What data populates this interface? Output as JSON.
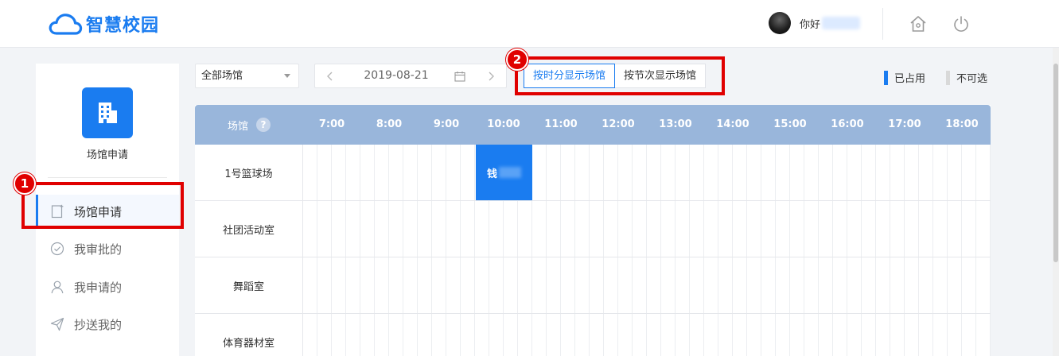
{
  "header": {
    "app_title": "智慧校园",
    "greeting": "你好",
    "brand_color": "#1a7cf0"
  },
  "sidebar": {
    "brand_label": "场馆申请",
    "items": [
      {
        "label": "场馆申请",
        "icon": "document-icon",
        "active": true
      },
      {
        "label": "我审批的",
        "icon": "check-circle-icon",
        "active": false
      },
      {
        "label": "我申请的",
        "icon": "person-icon",
        "active": false
      },
      {
        "label": "抄送我的",
        "icon": "send-icon",
        "active": false
      }
    ]
  },
  "toolbar": {
    "venue_select": "全部场馆",
    "date": "2019-08-21",
    "mode_by_time": "按时分显示场馆",
    "mode_by_period": "按节次显示场馆",
    "active_mode": "by_time"
  },
  "legend": {
    "occupied_label": "已占用",
    "occupied_color": "#1a7cf0",
    "unavailable_label": "不可选",
    "unavailable_color": "#d9d9d9"
  },
  "annotations": {
    "badge_1": "1",
    "badge_2": "2",
    "highlight_color": "#e00000"
  },
  "schedule": {
    "venue_header": "场馆",
    "hours": [
      "7:00",
      "8:00",
      "9:00",
      "10:00",
      "11:00",
      "12:00",
      "13:00",
      "14:00",
      "15:00",
      "16:00",
      "17:00",
      "18:00"
    ],
    "venues": [
      "1号篮球场",
      "社团活动室",
      "舞蹈室",
      "体育器材室"
    ],
    "bookings": [
      {
        "venue": "1号篮球场",
        "start": "10:00",
        "end": "11:00",
        "label": "钱"
      }
    ]
  }
}
